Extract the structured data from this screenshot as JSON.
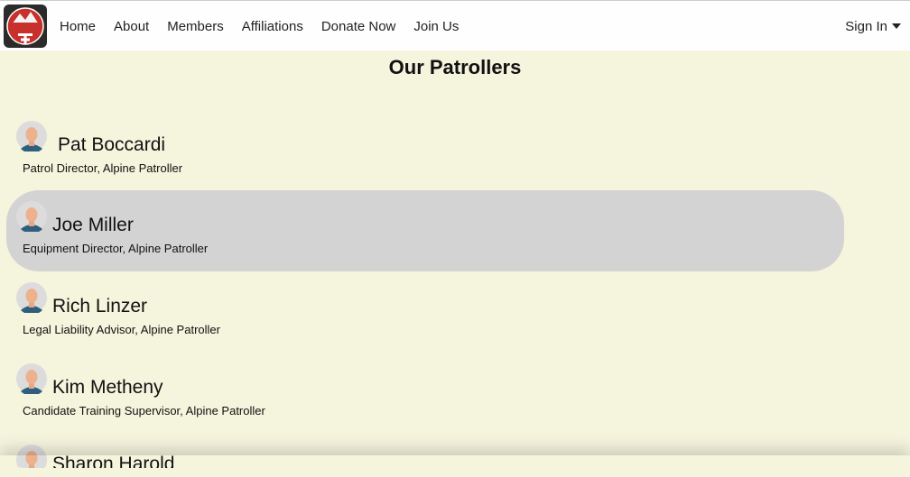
{
  "nav": {
    "links": [
      "Home",
      "About",
      "Members",
      "Affiliations",
      "Donate Now",
      "Join Us"
    ],
    "signin": "Sign In"
  },
  "logo": {
    "text_top": "SKI PATROL",
    "text_bottom": "BOGUS BASIN"
  },
  "page": {
    "title": "Our Patrollers"
  },
  "members": [
    {
      "name": "Pat Boccardi",
      "role": "Patrol Director, Alpine Patroller"
    },
    {
      "name": "Joe Miller",
      "role": "Equipment Director, Alpine Patroller"
    },
    {
      "name": "Rich Linzer",
      "role": "Legal Liability Advisor, Alpine Patroller"
    },
    {
      "name": "Kim Metheny",
      "role": "Candidate Training Supervisor, Alpine Patroller"
    },
    {
      "name": "Sharon Harold",
      "role": ""
    }
  ],
  "colors": {
    "background": "#f5f4dd",
    "highlight": "#d3d3d3",
    "navbar": "#fefefe"
  }
}
